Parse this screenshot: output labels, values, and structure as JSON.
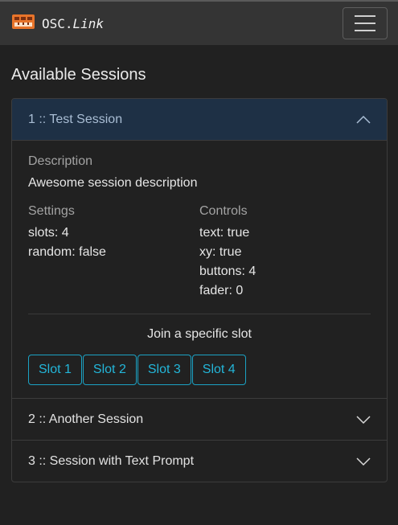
{
  "navbar": {
    "brand_prefix": "OSC.",
    "brand_italic": "Link"
  },
  "page": {
    "title": "Available Sessions"
  },
  "sessions": [
    {
      "header": "1 :: Test Session",
      "description_label": "Description",
      "description": "Awesome session description",
      "settings_label": "Settings",
      "settings": [
        "slots: 4",
        "random: false"
      ],
      "controls_label": "Controls",
      "controls": [
        "text: true",
        "xy: true",
        "buttons: 4",
        "fader: 0"
      ],
      "join_label": "Join a specific slot",
      "slots": [
        "Slot 1",
        "Slot 2",
        "Slot 3",
        "Slot 4"
      ]
    },
    {
      "header": "2 :: Another Session"
    },
    {
      "header": "3 :: Session with Text Prompt"
    }
  ],
  "colors": {
    "accent": "#23b6d9",
    "active_header_bg": "#1e3045",
    "logo": "#e8742a"
  }
}
